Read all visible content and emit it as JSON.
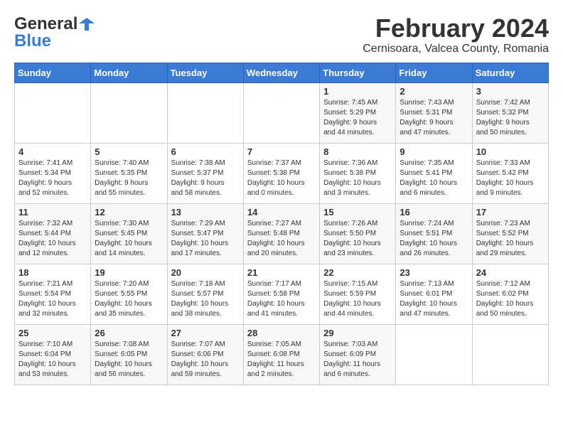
{
  "header": {
    "logo_general": "General",
    "logo_blue": "Blue",
    "month_year": "February 2024",
    "location": "Cernisoara, Valcea County, Romania"
  },
  "weekdays": [
    "Sunday",
    "Monday",
    "Tuesday",
    "Wednesday",
    "Thursday",
    "Friday",
    "Saturday"
  ],
  "weeks": [
    [
      {
        "day": "",
        "info": ""
      },
      {
        "day": "",
        "info": ""
      },
      {
        "day": "",
        "info": ""
      },
      {
        "day": "",
        "info": ""
      },
      {
        "day": "1",
        "info": "Sunrise: 7:45 AM\nSunset: 5:29 PM\nDaylight: 9 hours\nand 44 minutes."
      },
      {
        "day": "2",
        "info": "Sunrise: 7:43 AM\nSunset: 5:31 PM\nDaylight: 9 hours\nand 47 minutes."
      },
      {
        "day": "3",
        "info": "Sunrise: 7:42 AM\nSunset: 5:32 PM\nDaylight: 9 hours\nand 50 minutes."
      }
    ],
    [
      {
        "day": "4",
        "info": "Sunrise: 7:41 AM\nSunset: 5:34 PM\nDaylight: 9 hours\nand 52 minutes."
      },
      {
        "day": "5",
        "info": "Sunrise: 7:40 AM\nSunset: 5:35 PM\nDaylight: 9 hours\nand 55 minutes."
      },
      {
        "day": "6",
        "info": "Sunrise: 7:38 AM\nSunset: 5:37 PM\nDaylight: 9 hours\nand 58 minutes."
      },
      {
        "day": "7",
        "info": "Sunrise: 7:37 AM\nSunset: 5:38 PM\nDaylight: 10 hours\nand 0 minutes."
      },
      {
        "day": "8",
        "info": "Sunrise: 7:36 AM\nSunset: 5:38 PM\nDaylight: 10 hours\nand 3 minutes."
      },
      {
        "day": "9",
        "info": "Sunrise: 7:35 AM\nSunset: 5:41 PM\nDaylight: 10 hours\nand 6 minutes."
      },
      {
        "day": "10",
        "info": "Sunrise: 7:33 AM\nSunset: 5:42 PM\nDaylight: 10 hours\nand 9 minutes."
      }
    ],
    [
      {
        "day": "11",
        "info": "Sunrise: 7:32 AM\nSunset: 5:44 PM\nDaylight: 10 hours\nand 12 minutes."
      },
      {
        "day": "12",
        "info": "Sunrise: 7:30 AM\nSunset: 5:45 PM\nDaylight: 10 hours\nand 14 minutes."
      },
      {
        "day": "13",
        "info": "Sunrise: 7:29 AM\nSunset: 5:47 PM\nDaylight: 10 hours\nand 17 minutes."
      },
      {
        "day": "14",
        "info": "Sunrise: 7:27 AM\nSunset: 5:48 PM\nDaylight: 10 hours\nand 20 minutes."
      },
      {
        "day": "15",
        "info": "Sunrise: 7:26 AM\nSunset: 5:50 PM\nDaylight: 10 hours\nand 23 minutes."
      },
      {
        "day": "16",
        "info": "Sunrise: 7:24 AM\nSunset: 5:51 PM\nDaylight: 10 hours\nand 26 minutes."
      },
      {
        "day": "17",
        "info": "Sunrise: 7:23 AM\nSunset: 5:52 PM\nDaylight: 10 hours\nand 29 minutes."
      }
    ],
    [
      {
        "day": "18",
        "info": "Sunrise: 7:21 AM\nSunset: 5:54 PM\nDaylight: 10 hours\nand 32 minutes."
      },
      {
        "day": "19",
        "info": "Sunrise: 7:20 AM\nSunset: 5:55 PM\nDaylight: 10 hours\nand 35 minutes."
      },
      {
        "day": "20",
        "info": "Sunrise: 7:18 AM\nSunset: 5:57 PM\nDaylight: 10 hours\nand 38 minutes."
      },
      {
        "day": "21",
        "info": "Sunrise: 7:17 AM\nSunset: 5:58 PM\nDaylight: 10 hours\nand 41 minutes."
      },
      {
        "day": "22",
        "info": "Sunrise: 7:15 AM\nSunset: 5:59 PM\nDaylight: 10 hours\nand 44 minutes."
      },
      {
        "day": "23",
        "info": "Sunrise: 7:13 AM\nSunset: 6:01 PM\nDaylight: 10 hours\nand 47 minutes."
      },
      {
        "day": "24",
        "info": "Sunrise: 7:12 AM\nSunset: 6:02 PM\nDaylight: 10 hours\nand 50 minutes."
      }
    ],
    [
      {
        "day": "25",
        "info": "Sunrise: 7:10 AM\nSunset: 6:04 PM\nDaylight: 10 hours\nand 53 minutes."
      },
      {
        "day": "26",
        "info": "Sunrise: 7:08 AM\nSunset: 6:05 PM\nDaylight: 10 hours\nand 56 minutes."
      },
      {
        "day": "27",
        "info": "Sunrise: 7:07 AM\nSunset: 6:06 PM\nDaylight: 10 hours\nand 59 minutes."
      },
      {
        "day": "28",
        "info": "Sunrise: 7:05 AM\nSunset: 6:08 PM\nDaylight: 11 hours\nand 2 minutes."
      },
      {
        "day": "29",
        "info": "Sunrise: 7:03 AM\nSunset: 6:09 PM\nDaylight: 11 hours\nand 6 minutes."
      },
      {
        "day": "",
        "info": ""
      },
      {
        "day": "",
        "info": ""
      }
    ]
  ]
}
